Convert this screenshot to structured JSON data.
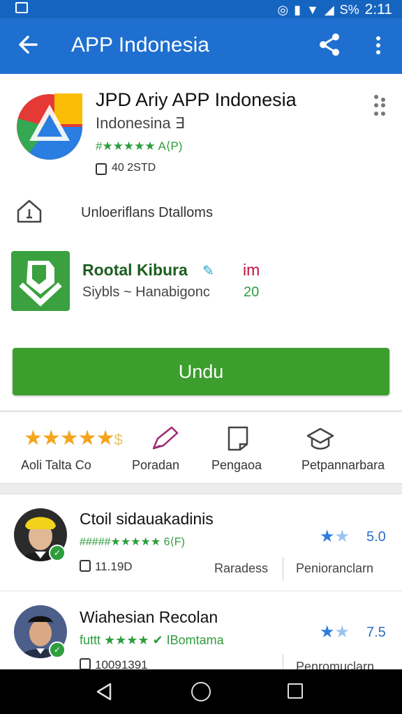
{
  "status_bar": {
    "battery": "S%",
    "time": "2:11"
  },
  "app_bar": {
    "title": "APP Indonesia"
  },
  "app_header": {
    "title": "JPD Ariy APP Indonesia",
    "subtitle": "Indonesina ∃",
    "rating": "#★★★★★ A⟨P)",
    "size": "40 2STD",
    "icon": "google-drive-style-logo"
  },
  "info_row": {
    "text": "Unloeriflans Dtalloms",
    "icon": "home-info-icon"
  },
  "publisher": {
    "name": "Rootal Kibura",
    "badge": "im",
    "subtitle": "Siybls ~ Hanabigonc",
    "number": "20",
    "icon": "download-shield-icon"
  },
  "install_button": {
    "label": "Undu"
  },
  "quick_actions": {
    "items": [
      {
        "label": "Aoli Talta Co",
        "icon": "star-rating-icon"
      },
      {
        "label": "Poradan",
        "icon": "pen-icon"
      },
      {
        "label": "Pengaoa",
        "icon": "book-icon"
      },
      {
        "label": "Petpannarbara",
        "icon": "graduation-cap-icon"
      }
    ],
    "star_color": "#f4a41d"
  },
  "reviews": [
    {
      "name": "Ctoil sidauakadinis",
      "stars_text": "#####★★★★★ 6⟨F)",
      "meta": "11.19D",
      "score": "5.0",
      "col1": "Raradess",
      "col2": "Penioranclarn"
    },
    {
      "name": "Wiahesian Recolan",
      "stars_text": "futtt ★★★★ ✔ IBomtama",
      "meta": "10091391",
      "score": "7.5",
      "col1": "",
      "col2": "Penromuclarn"
    }
  ],
  "colors": {
    "app_bar": "#1e6fd0",
    "install": "#3c9e2d",
    "rating_green": "#2e9d3c"
  }
}
